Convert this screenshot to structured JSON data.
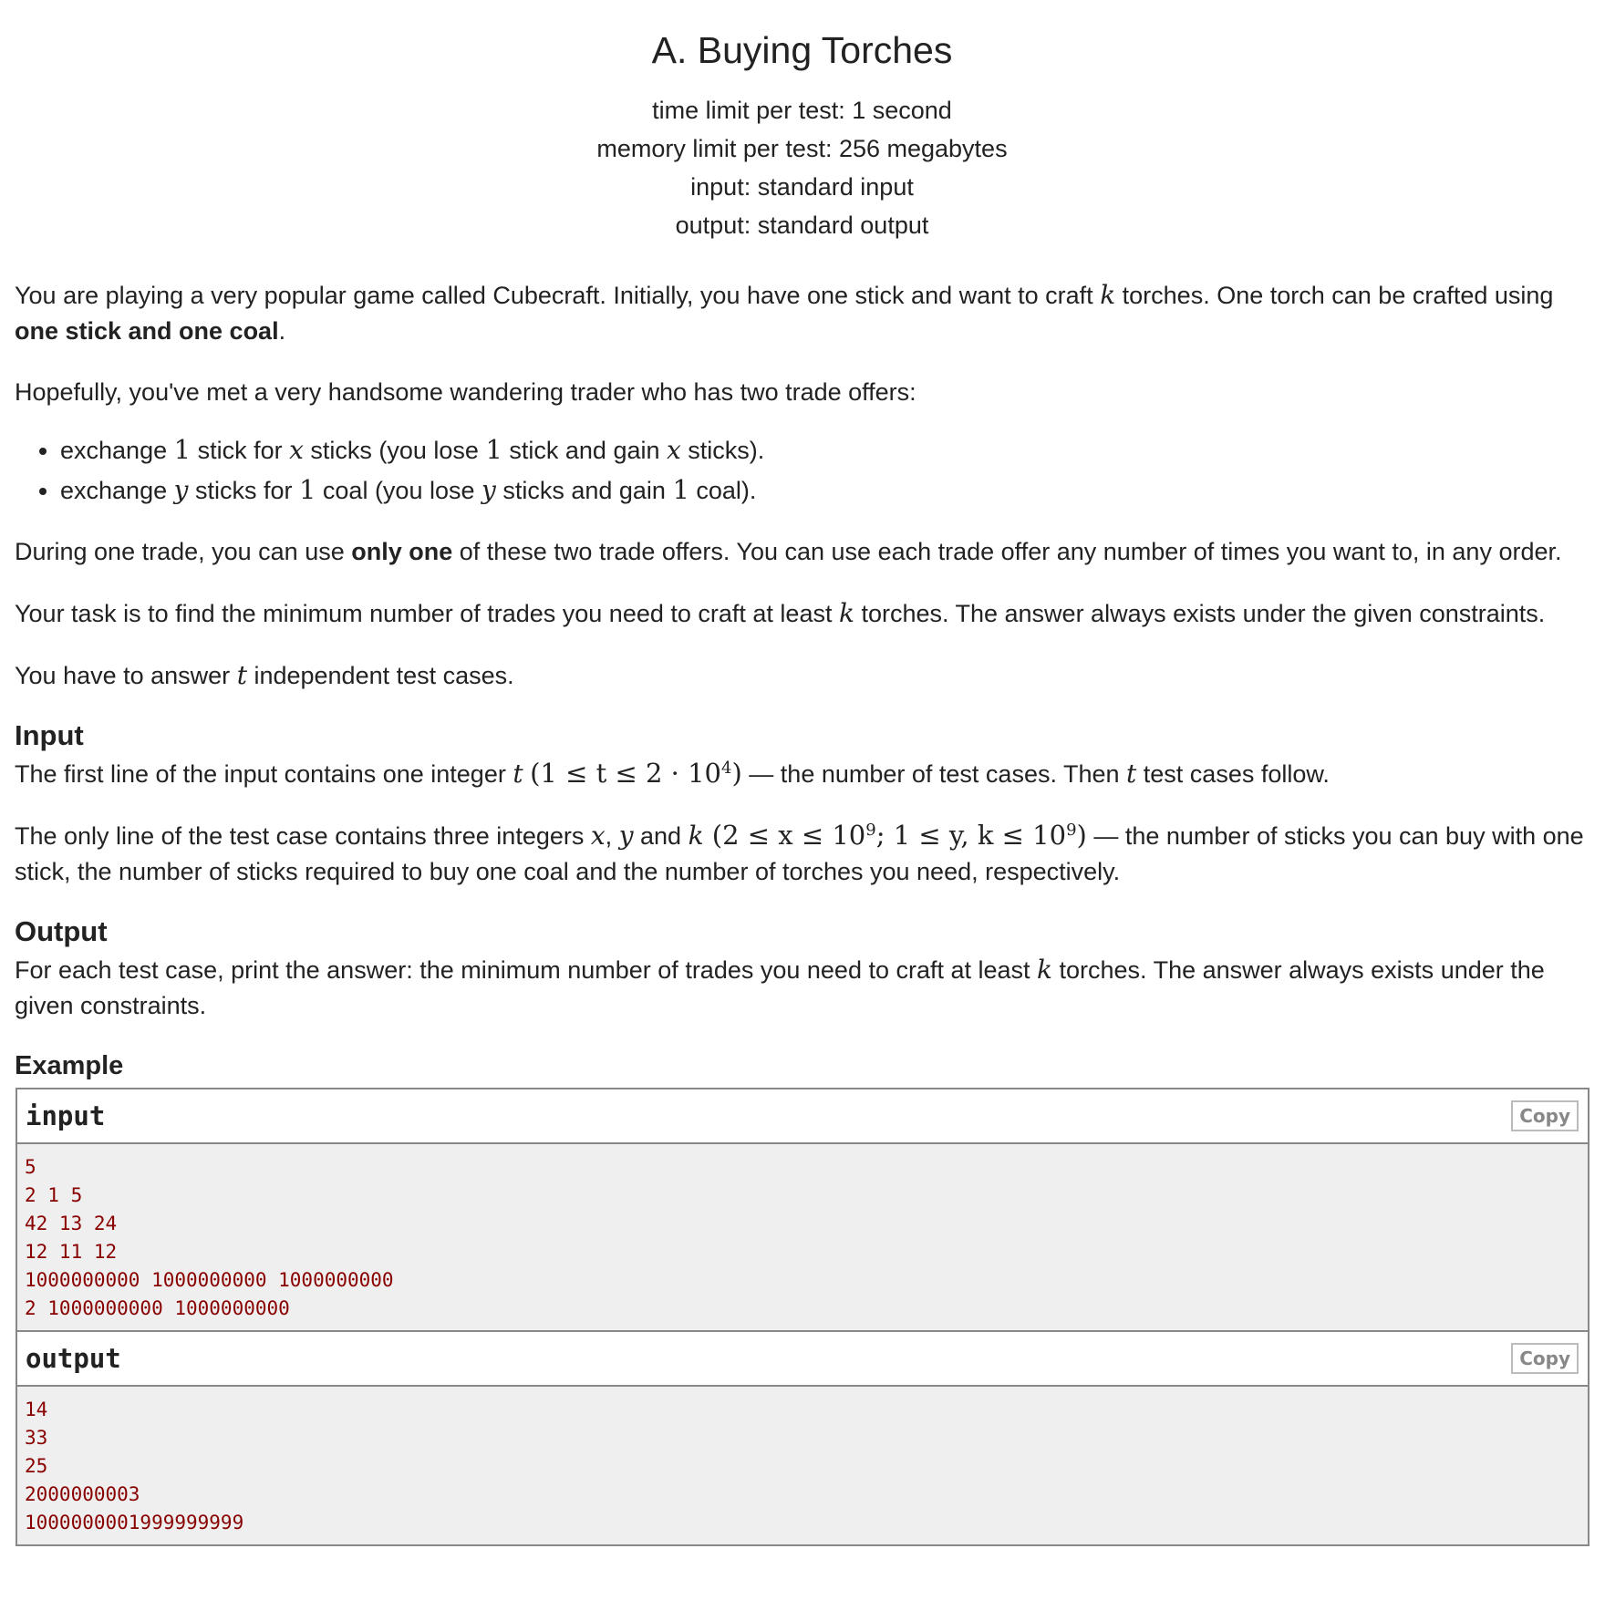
{
  "header": {
    "title": "A. Buying Torches",
    "time_limit": "time limit per test: 1 second",
    "memory_limit": "memory limit per test: 256 megabytes",
    "input_file": "input: standard input",
    "output_file": "output: standard output"
  },
  "legend": {
    "p1_a": "You are playing a very popular game called Cubecraft. Initially, you have one stick and want to craft ",
    "p1_k": "k",
    "p1_b": " torches. One torch can be crafted using ",
    "p1_bold": "one stick and one coal",
    "p1_c": ".",
    "p2": "Hopefully, you've met a very handsome wandering trader who has two trade offers:",
    "offers": [
      {
        "t1": "exchange ",
        "m1": "1",
        "t2": " stick for ",
        "m2": "x",
        "t3": " sticks (you lose ",
        "m3": "1",
        "t4": " stick and gain ",
        "m4": "x",
        "t5": " sticks)."
      },
      {
        "t1": "exchange ",
        "m1": "y",
        "t2": " sticks for ",
        "m2": "1",
        "t3": " coal (you lose ",
        "m3": "y",
        "t4": " sticks and gain ",
        "m4": "1",
        "t5": " coal)."
      }
    ],
    "p3_a": "During one trade, you can use ",
    "p3_bold": "only one",
    "p3_b": " of these two trade offers. You can use each trade offer any number of times you want to, in any order.",
    "p4_a": "Your task is to find the minimum number of trades you need to craft at least ",
    "p4_k": "k",
    "p4_b": " torches. The answer always exists under the given constraints.",
    "p5_a": "You have to answer ",
    "p5_t": "t",
    "p5_b": " independent test cases."
  },
  "input_spec": {
    "title": "Input",
    "l1_a": "The first line of the input contains one integer ",
    "l1_t": "t",
    "l1_math": "(1 ≤ t ≤ 2 · 10",
    "l1_exp": "4",
    "l1_close": ")",
    "l1_b": " — the number of test cases. Then ",
    "l1_t2": "t",
    "l1_c": " test cases follow.",
    "l2_a": "The only line of the test case contains three integers ",
    "l2_x": "x",
    "l2_comma": ", ",
    "l2_y": "y",
    "l2_and": " and ",
    "l2_k": "k",
    "l2_math1": " (2 ≤ x ≤ 10",
    "l2_exp1": "9",
    "l2_math2": "; 1 ≤ y, k ≤ 10",
    "l2_exp2": "9",
    "l2_close": ")",
    "l2_b": " — the number of sticks you can buy with one stick, the number of sticks required to buy one coal and the number of torches you need, respectively."
  },
  "output_spec": {
    "title": "Output",
    "a": "For each test case, print the answer: the minimum number of trades you need to craft at least ",
    "k": "k",
    "b": " torches. The answer always exists under the given constraints."
  },
  "example": {
    "title": "Example",
    "input_label": "input",
    "output_label": "output",
    "copy_label": "Copy",
    "input_lines": [
      "5",
      "2 1 5",
      "42 13 24",
      "12 11 12",
      "1000000000 1000000000 1000000000",
      "2 1000000000 1000000000"
    ],
    "output_lines": [
      "14",
      "33",
      "25",
      "2000000003",
      "1000000001999999999"
    ]
  }
}
